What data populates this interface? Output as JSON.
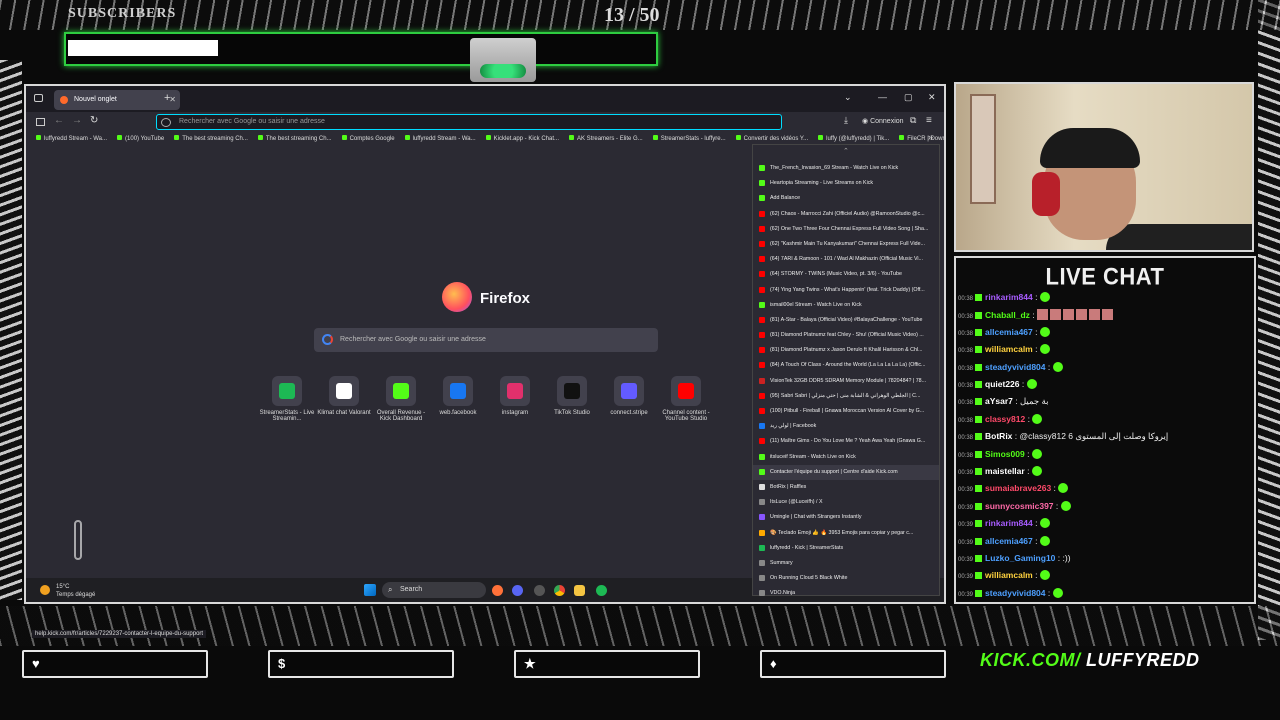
{
  "goal": {
    "label": "SUBSCRIBERS",
    "count": "13  / 50",
    "progress": 0.26
  },
  "browser": {
    "tab_title": "Nouvel onglet",
    "url_placeholder": "Rechercher avec Google ou saisir une adresse",
    "login_label": "Connexion",
    "bookmarks": [
      "luffyredd Stream - Wa...",
      "(100) YouTube",
      "The best streaming Ch...",
      "The best streaming Ch...",
      "Comptes Google",
      "luffyredd Stream - Wa...",
      "Kicklet.app - Kick Chat...",
      "AK Streamers - Elite G...",
      "StreamerStats - luffyre...",
      "Convertir des vidéos Y...",
      "luffy (@luffyredd) | Tik...",
      "FileCR | Download",
      "Elgato"
    ],
    "firefox_name": "Firefox",
    "search_placeholder": "Rechercher avec Google ou saisir une adresse",
    "shortcuts": [
      {
        "label": "StreamerStats - Live Streamin...",
        "color": "#1db954"
      },
      {
        "label": "Klimat chat Valorant",
        "color": "#ffffff"
      },
      {
        "label": "Overall Revenue - Kick Dashboard",
        "color": "#53fc18"
      },
      {
        "label": "web.facebook",
        "color": "#1877f2"
      },
      {
        "label": "instagram",
        "color": "#e1306c"
      },
      {
        "label": "TikTok Studio",
        "color": "#111111"
      },
      {
        "label": "connect.stripe",
        "color": "#635bff"
      },
      {
        "label": "Channel content - YouTube Studio",
        "color": "#ff0000"
      }
    ],
    "status_url": "help.kick.com/fr/articles/7229237-contacter-l-equipe-du-support",
    "history": [
      {
        "text": "The_French_Invasion_69 Stream - Watch Live on Kick",
        "color": "#53fc18"
      },
      {
        "text": "Heartopia Streaming - Live Streams on Kick",
        "color": "#53fc18"
      },
      {
        "text": "Add Balance",
        "color": "#53fc18"
      },
      {
        "text": "(62) Chaos - Marrocci Zahi (Officiel Audio) @RamoonStudio @c...",
        "color": "#ff0000"
      },
      {
        "text": "(62) One Two Three Four Chennai Express Full Video Song | Sha...",
        "color": "#ff0000"
      },
      {
        "text": "(62) \"Kashmir Main Tu Kanyakumari\" Chennai Express Full Vide...",
        "color": "#ff0000"
      },
      {
        "text": "(64) 7ARI & Ramoon - 101 / Wad Al Makhazin (Official Music Vi...",
        "color": "#ff0000"
      },
      {
        "text": "(64) STORMY - TWINS (Music Video, pt. 3/6) - YouTube",
        "color": "#ff0000"
      },
      {
        "text": "(74) Ying Yang Twins - What's Happenin' (feat. Trick Daddy) (Off...",
        "color": "#ff0000"
      },
      {
        "text": "ismail00el Stream - Watch Live on Kick",
        "color": "#53fc18"
      },
      {
        "text": "(81) A-Star - Balaya (Official Video) #BalayaChallenge - YouTube",
        "color": "#ff0000"
      },
      {
        "text": "(81) Diamond Platnumz feat Chley - Shu! (Official Music Video) ...",
        "color": "#ff0000"
      },
      {
        "text": "(81) Diamond Platnumz x Jason Derulo ft Khalil Harisson & Chl...",
        "color": "#ff0000"
      },
      {
        "text": "(84) A Touch Of Class - Around the World (La La La La La) (Offic...",
        "color": "#ff0000"
      },
      {
        "text": "VisionTek 32GB DDR5 SDRAM Memory Module | 7820484? | 78...",
        "color": "#cc2222"
      },
      {
        "text": "(95) Sabri Sabri | الجلطي الوهراني & الشابة منى | حتي منزلي | C...",
        "color": "#ff0000"
      },
      {
        "text": "(100) Pitbull - Fireball | Gnawa Moroccan Version AI Cover by G...",
        "color": "#ff0000"
      },
      {
        "text": "لولي ريد | Facebook",
        "color": "#1877f2"
      },
      {
        "text": "(11) Maître Gims - Do You Love Me ? Yeah Awa Yeah (Gnawa G...",
        "color": "#ff0000"
      },
      {
        "text": "itsluceif Stream - Watch Live on Kick",
        "color": "#53fc18"
      },
      {
        "text": "Contacter l'équipe du support | Centre d'aide Kick.com",
        "color": "#53fc18"
      },
      {
        "text": "BotRix | Raffles",
        "color": "#dddddd"
      },
      {
        "text": "ItsLuce (@Luceifh) / X",
        "color": "#888888"
      },
      {
        "text": "Umingle | Chat with Strangers Instantly",
        "color": "#8855ff"
      },
      {
        "text": "🎨 Teclado Emoji 👍 🔥 3953 Emojis para copiar y pegar c...",
        "color": "#ffaa00"
      },
      {
        "text": "luffyredd - Kick | StreamerStats",
        "color": "#1db954"
      },
      {
        "text": "Summary",
        "color": "#888888"
      },
      {
        "text": "On Running Cloud 5 Black White",
        "color": "#888888"
      },
      {
        "text": "VDO.Ninja",
        "color": "#888888"
      }
    ],
    "weather_temp": "15°C",
    "weather_text": "Temps dégagé",
    "taskbar_search": "Search"
  },
  "chat": {
    "title": "LIVE CHAT",
    "messages": [
      {
        "time": "00:38",
        "user": "rinkarim844",
        "color": "#a85cff",
        "text": ""
      },
      {
        "time": "00:38",
        "user": "Chaball_dz",
        "color": "#53fc18",
        "text": ""
      },
      {
        "time": "00:38",
        "user": "allcemia467",
        "color": "#4ea0ff",
        "text": ""
      },
      {
        "time": "00:38",
        "user": "williamcalm",
        "color": "#ffd23f",
        "text": ""
      },
      {
        "time": "00:38",
        "user": "steadyvivid804",
        "color": "#4ea0ff",
        "text": ""
      },
      {
        "time": "00:38",
        "user": "quiet226",
        "color": "#ffffff",
        "text": ""
      },
      {
        "time": "00:38",
        "user": "aYsar7",
        "color": "#ffffff",
        "text": "بة جميل"
      },
      {
        "time": "00:38",
        "user": "classy812",
        "color": "#ff4a6a",
        "text": ""
      },
      {
        "time": "00:38",
        "user": "BotRix",
        "color": "#ffffff",
        "text": "@classy812 إيروكا وصلت إلى المستوى 6"
      },
      {
        "time": "00:38",
        "user": "Simos009",
        "color": "#53fc18",
        "text": ""
      },
      {
        "time": "00:39",
        "user": "maistellar",
        "color": "#ffffff",
        "text": ""
      },
      {
        "time": "00:39",
        "user": "sumaiabrave263",
        "color": "#ff4a6a",
        "text": ""
      },
      {
        "time": "00:39",
        "user": "sunnycosmic397",
        "color": "#ff6aa8",
        "text": ""
      },
      {
        "time": "00:39",
        "user": "rinkarim844",
        "color": "#a85cff",
        "text": ""
      },
      {
        "time": "00:39",
        "user": "allcemia467",
        "color": "#4ea0ff",
        "text": ""
      },
      {
        "time": "00:39",
        "user": "Luzko_Gaming10",
        "color": "#4ea0ff",
        "text": ":))"
      },
      {
        "time": "00:39",
        "user": "williamcalm",
        "color": "#ffd23f",
        "text": ""
      },
      {
        "time": "00:39",
        "user": "steadyvivid804",
        "color": "#4ea0ff",
        "text": ""
      }
    ]
  },
  "bottom_icons": [
    "heart-icon",
    "dollar-icon",
    "star-icon",
    "drop-icon"
  ],
  "bottom_glyphs": [
    "♥",
    "$",
    "★",
    "♦"
  ],
  "kick": {
    "domain": "KICK.COM/",
    "user": " LUFFYREDD"
  }
}
